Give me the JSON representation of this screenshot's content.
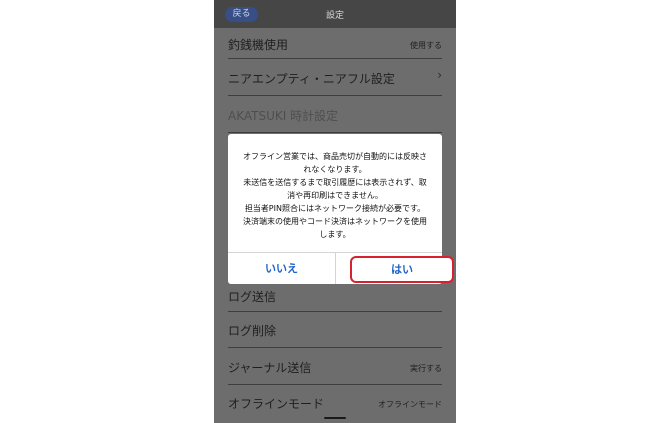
{
  "header": {
    "back_label": "戻る",
    "title": "設定"
  },
  "settings": {
    "change_machine": {
      "label": "釣銭機使用",
      "value": "使用する"
    },
    "near_empty": {
      "label": "ニアエンプティ・ニアフル設定",
      "chevron": "›"
    },
    "akatsuki_time": {
      "label": "AKATSUKI 時計設定"
    },
    "log_send": {
      "label": "ログ送信"
    },
    "log_delete": {
      "label": "ログ削除"
    },
    "journal_send": {
      "label": "ジャーナル送信",
      "value": "実行する"
    },
    "offline_mode": {
      "label": "オフラインモード",
      "value": "オフラインモード"
    }
  },
  "dialog": {
    "message_lines": [
      "オフライン営業では、商品売切が自動的には反映さ",
      "れなくなります。",
      "未送信を送信するまで取引履歴には表示されず、取",
      "消や再印刷はできません。",
      "担当者PIN照合にはネットワーク接続が必要です。",
      "決済端末の使用やコード決済はネットワークを使用",
      "します。"
    ],
    "no_label": "いいえ",
    "yes_label": "はい"
  },
  "colors": {
    "overlay_background": "#6d6d6d",
    "header_background": "#464646",
    "back_button": "#374f86",
    "button_text": "#1d63c9",
    "highlight_border": "#d8212e"
  }
}
